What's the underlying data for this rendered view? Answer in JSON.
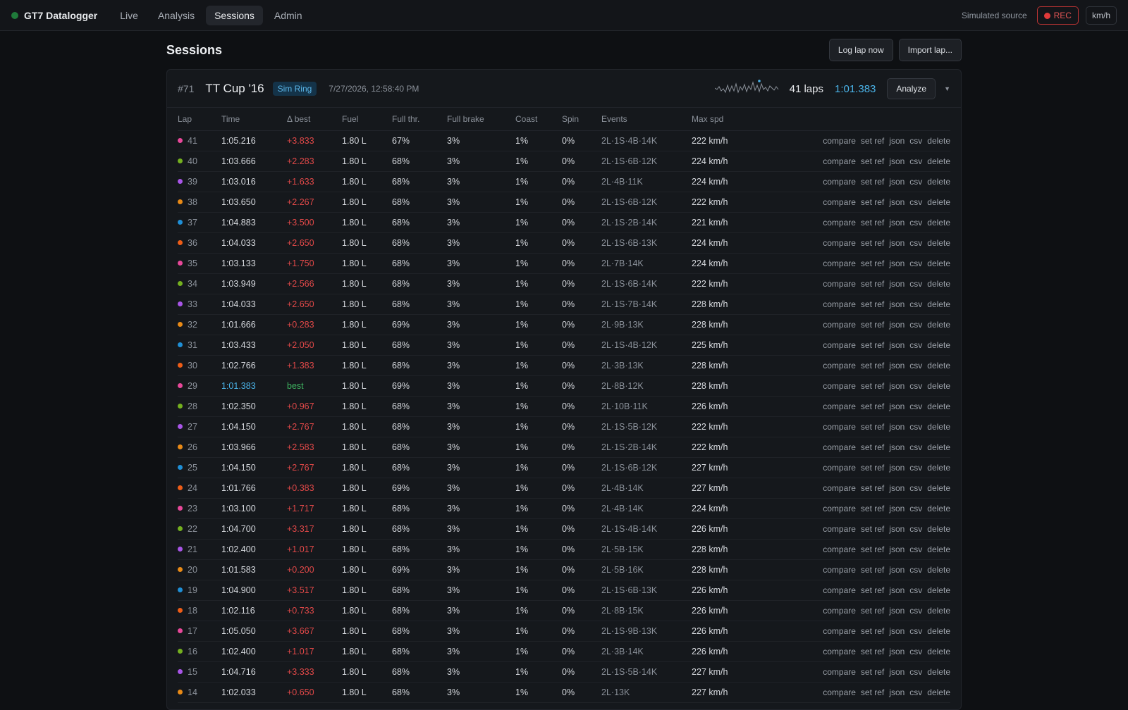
{
  "app": {
    "brand": "GT7 Datalogger",
    "nav": [
      {
        "label": "Live",
        "active": false
      },
      {
        "label": "Analysis",
        "active": false
      },
      {
        "label": "Sessions",
        "active": true
      },
      {
        "label": "Admin",
        "active": false
      }
    ],
    "source": "Simulated source",
    "rec_label": "REC",
    "unit_label": "km/h"
  },
  "page": {
    "title": "Sessions",
    "log_lap_label": "Log lap now",
    "import_lap_label": "Import lap..."
  },
  "session": {
    "id": "#71",
    "car": "TT Cup '16",
    "track": "Sim Ring",
    "date": "7/27/2026, 12:58:40 PM",
    "laps": "41 laps",
    "best": "1:01.383",
    "analyze_label": "Analyze",
    "expand_icon": "chevron-down-icon"
  },
  "table": {
    "headers": [
      "Lap",
      "Time",
      "Δ best",
      "Fuel",
      "Full thr.",
      "Full brake",
      "Coast",
      "Spin",
      "Events",
      "Max spd"
    ],
    "actions": [
      "compare",
      "set ref",
      "json",
      "csv",
      "delete"
    ],
    "lap_colors": [
      "#e8489a",
      "#74b01f",
      "#a955e8",
      "#e98a16",
      "#1f8fd6",
      "#ee5d17"
    ],
    "rows": [
      {
        "lap": "41",
        "time": "1:05.216",
        "delta": "+3.833",
        "fuel": "1.80 L",
        "thr": "67%",
        "brake": "3%",
        "coast": "1%",
        "spin": "0%",
        "events": "2L·1S·4B·14K",
        "max": "222 km/h",
        "color": "#e8489a"
      },
      {
        "lap": "40",
        "time": "1:03.666",
        "delta": "+2.283",
        "fuel": "1.80 L",
        "thr": "68%",
        "brake": "3%",
        "coast": "1%",
        "spin": "0%",
        "events": "2L·1S·6B·12K",
        "max": "224 km/h",
        "color": "#74b01f"
      },
      {
        "lap": "39",
        "time": "1:03.016",
        "delta": "+1.633",
        "fuel": "1.80 L",
        "thr": "68%",
        "brake": "3%",
        "coast": "1%",
        "spin": "0%",
        "events": "2L·4B·11K",
        "max": "224 km/h",
        "color": "#a955e8"
      },
      {
        "lap": "38",
        "time": "1:03.650",
        "delta": "+2.267",
        "fuel": "1.80 L",
        "thr": "68%",
        "brake": "3%",
        "coast": "1%",
        "spin": "0%",
        "events": "2L·1S·6B·12K",
        "max": "222 km/h",
        "color": "#e98a16"
      },
      {
        "lap": "37",
        "time": "1:04.883",
        "delta": "+3.500",
        "fuel": "1.80 L",
        "thr": "68%",
        "brake": "3%",
        "coast": "1%",
        "spin": "0%",
        "events": "2L·1S·2B·14K",
        "max": "221 km/h",
        "color": "#1f8fd6"
      },
      {
        "lap": "36",
        "time": "1:04.033",
        "delta": "+2.650",
        "fuel": "1.80 L",
        "thr": "68%",
        "brake": "3%",
        "coast": "1%",
        "spin": "0%",
        "events": "2L·1S·6B·13K",
        "max": "224 km/h",
        "color": "#ee5d17"
      },
      {
        "lap": "35",
        "time": "1:03.133",
        "delta": "+1.750",
        "fuel": "1.80 L",
        "thr": "68%",
        "brake": "3%",
        "coast": "1%",
        "spin": "0%",
        "events": "2L·7B·14K",
        "max": "224 km/h",
        "color": "#e8489a"
      },
      {
        "lap": "34",
        "time": "1:03.949",
        "delta": "+2.566",
        "fuel": "1.80 L",
        "thr": "68%",
        "brake": "3%",
        "coast": "1%",
        "spin": "0%",
        "events": "2L·1S·6B·14K",
        "max": "222 km/h",
        "color": "#74b01f"
      },
      {
        "lap": "33",
        "time": "1:04.033",
        "delta": "+2.650",
        "fuel": "1.80 L",
        "thr": "68%",
        "brake": "3%",
        "coast": "1%",
        "spin": "0%",
        "events": "2L·1S·7B·14K",
        "max": "228 km/h",
        "color": "#a955e8"
      },
      {
        "lap": "32",
        "time": "1:01.666",
        "delta": "+0.283",
        "fuel": "1.80 L",
        "thr": "69%",
        "brake": "3%",
        "coast": "1%",
        "spin": "0%",
        "events": "2L·9B·13K",
        "max": "228 km/h",
        "color": "#e98a16"
      },
      {
        "lap": "31",
        "time": "1:03.433",
        "delta": "+2.050",
        "fuel": "1.80 L",
        "thr": "68%",
        "brake": "3%",
        "coast": "1%",
        "spin": "0%",
        "events": "2L·1S·4B·12K",
        "max": "225 km/h",
        "color": "#1f8fd6"
      },
      {
        "lap": "30",
        "time": "1:02.766",
        "delta": "+1.383",
        "fuel": "1.80 L",
        "thr": "68%",
        "brake": "3%",
        "coast": "1%",
        "spin": "0%",
        "events": "2L·3B·13K",
        "max": "228 km/h",
        "color": "#ee5d17"
      },
      {
        "lap": "29",
        "time": "1:01.383",
        "delta": "best",
        "fuel": "1.80 L",
        "thr": "69%",
        "brake": "3%",
        "coast": "1%",
        "spin": "0%",
        "events": "2L·8B·12K",
        "max": "228 km/h",
        "color": "#e8489a",
        "is_best": true
      },
      {
        "lap": "28",
        "time": "1:02.350",
        "delta": "+0.967",
        "fuel": "1.80 L",
        "thr": "68%",
        "brake": "3%",
        "coast": "1%",
        "spin": "0%",
        "events": "2L·10B·11K",
        "max": "226 km/h",
        "color": "#74b01f"
      },
      {
        "lap": "27",
        "time": "1:04.150",
        "delta": "+2.767",
        "fuel": "1.80 L",
        "thr": "68%",
        "brake": "3%",
        "coast": "1%",
        "spin": "0%",
        "events": "2L·1S·5B·12K",
        "max": "222 km/h",
        "color": "#a955e8"
      },
      {
        "lap": "26",
        "time": "1:03.966",
        "delta": "+2.583",
        "fuel": "1.80 L",
        "thr": "68%",
        "brake": "3%",
        "coast": "1%",
        "spin": "0%",
        "events": "2L·1S·2B·14K",
        "max": "222 km/h",
        "color": "#e98a16"
      },
      {
        "lap": "25",
        "time": "1:04.150",
        "delta": "+2.767",
        "fuel": "1.80 L",
        "thr": "68%",
        "brake": "3%",
        "coast": "1%",
        "spin": "0%",
        "events": "2L·1S·6B·12K",
        "max": "227 km/h",
        "color": "#1f8fd6"
      },
      {
        "lap": "24",
        "time": "1:01.766",
        "delta": "+0.383",
        "fuel": "1.80 L",
        "thr": "69%",
        "brake": "3%",
        "coast": "1%",
        "spin": "0%",
        "events": "2L·4B·14K",
        "max": "227 km/h",
        "color": "#ee5d17"
      },
      {
        "lap": "23",
        "time": "1:03.100",
        "delta": "+1.717",
        "fuel": "1.80 L",
        "thr": "68%",
        "brake": "3%",
        "coast": "1%",
        "spin": "0%",
        "events": "2L·4B·14K",
        "max": "224 km/h",
        "color": "#e8489a"
      },
      {
        "lap": "22",
        "time": "1:04.700",
        "delta": "+3.317",
        "fuel": "1.80 L",
        "thr": "68%",
        "brake": "3%",
        "coast": "1%",
        "spin": "0%",
        "events": "2L·1S·4B·14K",
        "max": "226 km/h",
        "color": "#74b01f"
      },
      {
        "lap": "21",
        "time": "1:02.400",
        "delta": "+1.017",
        "fuel": "1.80 L",
        "thr": "68%",
        "brake": "3%",
        "coast": "1%",
        "spin": "0%",
        "events": "2L·5B·15K",
        "max": "228 km/h",
        "color": "#a955e8"
      },
      {
        "lap": "20",
        "time": "1:01.583",
        "delta": "+0.200",
        "fuel": "1.80 L",
        "thr": "69%",
        "brake": "3%",
        "coast": "1%",
        "spin": "0%",
        "events": "2L·5B·16K",
        "max": "228 km/h",
        "color": "#e98a16"
      },
      {
        "lap": "19",
        "time": "1:04.900",
        "delta": "+3.517",
        "fuel": "1.80 L",
        "thr": "68%",
        "brake": "3%",
        "coast": "1%",
        "spin": "0%",
        "events": "2L·1S·6B·13K",
        "max": "226 km/h",
        "color": "#1f8fd6"
      },
      {
        "lap": "18",
        "time": "1:02.116",
        "delta": "+0.733",
        "fuel": "1.80 L",
        "thr": "68%",
        "brake": "3%",
        "coast": "1%",
        "spin": "0%",
        "events": "2L·8B·15K",
        "max": "226 km/h",
        "color": "#ee5d17"
      },
      {
        "lap": "17",
        "time": "1:05.050",
        "delta": "+3.667",
        "fuel": "1.80 L",
        "thr": "68%",
        "brake": "3%",
        "coast": "1%",
        "spin": "0%",
        "events": "2L·1S·9B·13K",
        "max": "226 km/h",
        "color": "#e8489a"
      },
      {
        "lap": "16",
        "time": "1:02.400",
        "delta": "+1.017",
        "fuel": "1.80 L",
        "thr": "68%",
        "brake": "3%",
        "coast": "1%",
        "spin": "0%",
        "events": "2L·3B·14K",
        "max": "226 km/h",
        "color": "#74b01f"
      },
      {
        "lap": "15",
        "time": "1:04.716",
        "delta": "+3.333",
        "fuel": "1.80 L",
        "thr": "68%",
        "brake": "3%",
        "coast": "1%",
        "spin": "0%",
        "events": "2L·1S·5B·14K",
        "max": "227 km/h",
        "color": "#a955e8"
      },
      {
        "lap": "14",
        "time": "1:02.033",
        "delta": "+0.650",
        "fuel": "1.80 L",
        "thr": "68%",
        "brake": "3%",
        "coast": "1%",
        "spin": "0%",
        "events": "2L·13K",
        "max": "227 km/h",
        "color": "#e98a16"
      }
    ]
  }
}
